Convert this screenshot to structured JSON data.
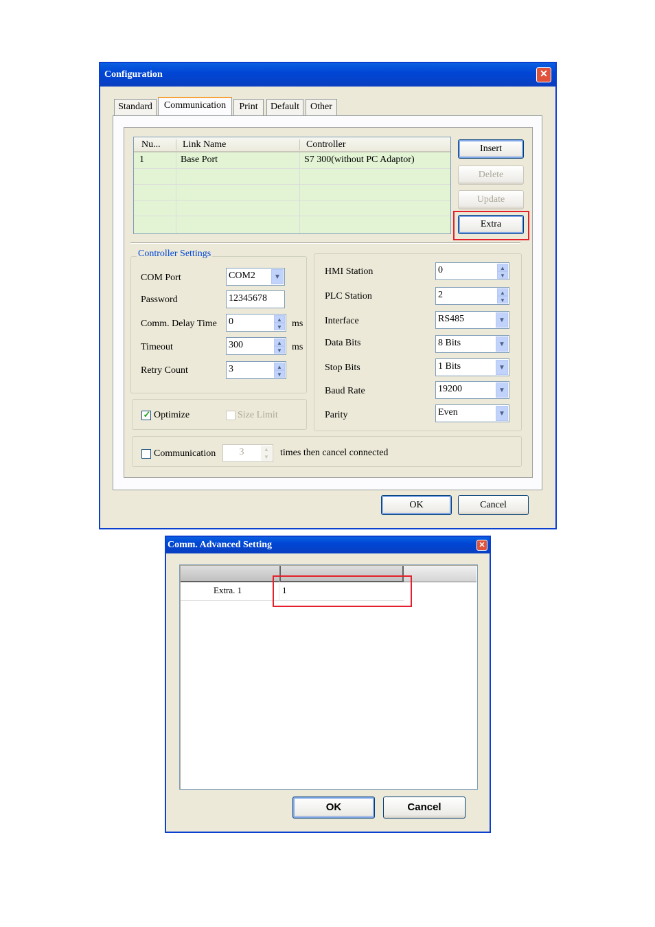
{
  "config": {
    "title": "Configuration",
    "tabs": [
      "Standard",
      "Communication",
      "Print",
      "Default",
      "Other"
    ],
    "active_tab": "Communication",
    "table": {
      "headers": [
        "Nu...",
        "Link Name",
        "Controller"
      ],
      "rows": [
        [
          "1",
          "Base Port",
          "S7 300(without PC Adaptor)"
        ]
      ]
    },
    "buttons": {
      "insert": "Insert",
      "delete": "Delete",
      "update": "Update",
      "extra": "Extra",
      "ok": "OK",
      "cancel": "Cancel"
    },
    "controller_settings": {
      "title": "Controller Settings",
      "com_port_label": "COM Port",
      "com_port_value": "COM2",
      "password_label": "Password",
      "password_value": "12345678",
      "delay_label": "Comm. Delay Time",
      "delay_value": "0",
      "delay_unit": "ms",
      "timeout_label": "Timeout",
      "timeout_value": "300",
      "timeout_unit": "ms",
      "retry_label": "Retry Count",
      "retry_value": "3"
    },
    "optimize_label": "Optimize",
    "size_limit_label": "Size Limit",
    "station": {
      "hmi_label": "HMI Station",
      "hmi_value": "0",
      "plc_label": "PLC Station",
      "plc_value": "2",
      "interface_label": "Interface",
      "interface_value": "RS485",
      "databits_label": "Data Bits",
      "databits_value": "8 Bits",
      "stopbits_label": "Stop Bits",
      "stopbits_value": "1 Bits",
      "baud_label": "Baud Rate",
      "baud_value": "19200",
      "parity_label": "Parity",
      "parity_value": "Even"
    },
    "comm_retry": {
      "label": "Communication",
      "value": "3",
      "suffix": "times then cancel connected"
    }
  },
  "advanced": {
    "title": "Comm. Advanced Setting",
    "row_label": "Extra. 1",
    "row_value": "1",
    "ok": "OK",
    "cancel": "Cancel"
  },
  "icons": [
    "close-icon",
    "chevron-down-icon",
    "spin-up-icon",
    "spin-down-icon",
    "checkmark-icon"
  ],
  "colors": {
    "title_bar": "#0046d5",
    "dialog_bg": "#ece9d8",
    "table_bg": "#e2f4d4",
    "highlight": "#e3202b"
  }
}
